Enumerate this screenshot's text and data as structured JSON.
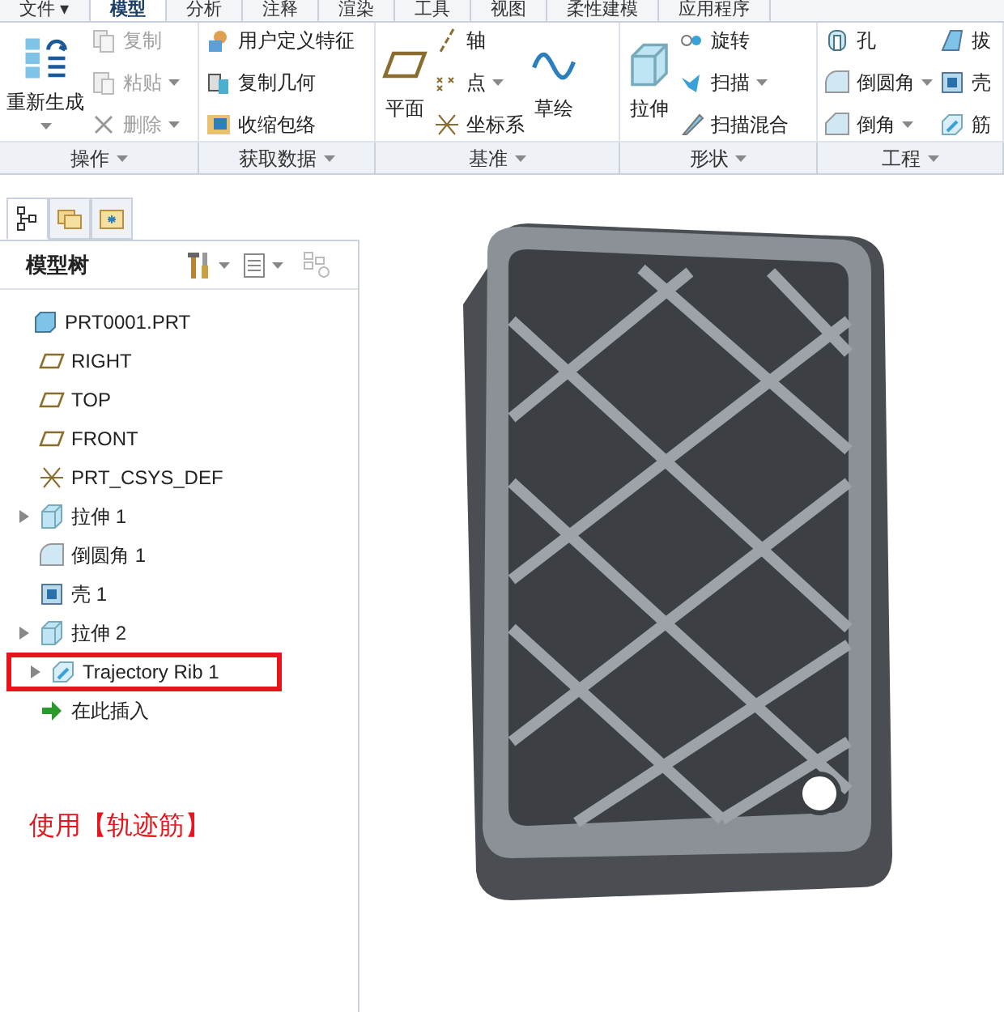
{
  "menu_tabs": [
    {
      "label": "文件 ▾",
      "selected": false
    },
    {
      "label": "模型",
      "selected": true
    },
    {
      "label": "分析",
      "selected": false
    },
    {
      "label": "注释",
      "selected": false
    },
    {
      "label": "渲染",
      "selected": false
    },
    {
      "label": "工具",
      "selected": false
    },
    {
      "label": "视图",
      "selected": false
    },
    {
      "label": "柔性建模",
      "selected": false
    },
    {
      "label": "应用程序",
      "selected": false
    }
  ],
  "ribbon_groups": [
    {
      "label": "操作",
      "large": [
        {
          "label": "重新生成",
          "kind": "regen",
          "dropdown": true
        }
      ],
      "columns": [
        [
          {
            "label": "复制",
            "kind": "copy",
            "disabled": true,
            "dropdown": false
          },
          {
            "label": "粘贴",
            "kind": "paste",
            "disabled": true,
            "dropdown": true
          },
          {
            "label": "删除",
            "kind": "delete",
            "disabled": true,
            "dropdown": true
          }
        ]
      ]
    },
    {
      "label": "获取数据",
      "columns": [
        [
          {
            "label": "用户定义特征",
            "kind": "udf",
            "disabled": false,
            "dropdown": false
          },
          {
            "label": "复制几何",
            "kind": "copygeom",
            "disabled": false,
            "dropdown": false
          },
          {
            "label": "收缩包络",
            "kind": "shrink",
            "disabled": false,
            "dropdown": false
          }
        ]
      ]
    },
    {
      "label": "基准",
      "large": [
        {
          "label": "平面",
          "kind": "plane",
          "dropdown": false
        }
      ],
      "columns": [
        [
          {
            "label": "轴",
            "kind": "axis",
            "disabled": false,
            "dropdown": false
          },
          {
            "label": "点",
            "kind": "point",
            "disabled": false,
            "dropdown": true
          },
          {
            "label": "坐标系",
            "kind": "csys",
            "disabled": false,
            "dropdown": false
          }
        ]
      ],
      "large_after": [
        {
          "label": "草绘",
          "kind": "sketch",
          "dropdown": false
        }
      ]
    },
    {
      "label": "形状",
      "large": [
        {
          "label": "拉伸",
          "kind": "extrude",
          "dropdown": false
        }
      ],
      "columns": [
        [
          {
            "label": "旋转",
            "kind": "revolve",
            "disabled": false,
            "dropdown": false
          },
          {
            "label": "扫描",
            "kind": "sweep",
            "disabled": false,
            "dropdown": true
          },
          {
            "label": "扫描混合",
            "kind": "sweepblend",
            "disabled": false,
            "dropdown": false
          }
        ]
      ]
    },
    {
      "label": "工程",
      "columns": [
        [
          {
            "label": "孔",
            "kind": "hole",
            "disabled": false,
            "dropdown": false
          },
          {
            "label": "倒圆角",
            "kind": "round",
            "disabled": false,
            "dropdown": true
          },
          {
            "label": "倒角",
            "kind": "chamfer",
            "disabled": false,
            "dropdown": true
          }
        ],
        [
          {
            "label": "拔",
            "kind": "draft",
            "disabled": false,
            "dropdown": false
          },
          {
            "label": "壳",
            "kind": "shell",
            "disabled": false,
            "dropdown": false
          },
          {
            "label": "筋",
            "kind": "rib",
            "disabled": false,
            "dropdown": false
          }
        ]
      ]
    }
  ],
  "panel_tabs": [
    {
      "kind": "tree",
      "selected": true
    },
    {
      "kind": "folder",
      "selected": false
    },
    {
      "kind": "favorites",
      "selected": false
    }
  ],
  "model_tree": {
    "title": "模型树",
    "items": [
      {
        "label": "PRT0001.PRT",
        "kind": "part",
        "expandable": false,
        "boxed": false,
        "children": [
          {
            "label": "RIGHT",
            "kind": "plane",
            "expandable": false,
            "boxed": false
          },
          {
            "label": "TOP",
            "kind": "plane",
            "expandable": false,
            "boxed": false
          },
          {
            "label": "FRONT",
            "kind": "plane",
            "expandable": false,
            "boxed": false
          },
          {
            "label": "PRT_CSYS_DEF",
            "kind": "csys",
            "expandable": false,
            "boxed": false
          },
          {
            "label": "拉伸 1",
            "kind": "extrude",
            "expandable": true,
            "boxed": false
          },
          {
            "label": "倒圆角 1",
            "kind": "round",
            "expandable": false,
            "boxed": false
          },
          {
            "label": "壳 1",
            "kind": "shell",
            "expandable": false,
            "boxed": false
          },
          {
            "label": "拉伸 2",
            "kind": "extrude",
            "expandable": true,
            "boxed": false
          },
          {
            "label": "Trajectory Rib 1",
            "kind": "rib",
            "expandable": true,
            "boxed": true
          },
          {
            "label": "在此插入",
            "kind": "insert",
            "expandable": false,
            "boxed": false
          }
        ]
      }
    ]
  },
  "annotation": "使用【轨迹筋】"
}
